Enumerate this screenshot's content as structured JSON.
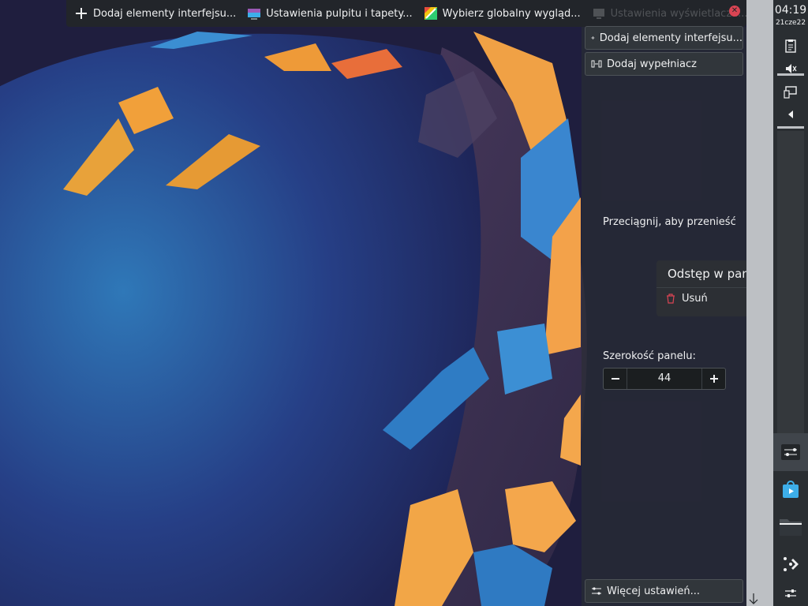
{
  "toolbox": {
    "items": [
      {
        "label": "Dodaj elementy interfejsu...",
        "icon": "plus-icon"
      },
      {
        "label": "Ustawienia pulpitu i tapety...",
        "icon": "desktop-settings-icon"
      },
      {
        "label": "Wybierz globalny wygląd...",
        "icon": "global-theme-icon"
      },
      {
        "label": "Ustawienia wyświetlacza...",
        "icon": "monitor-icon"
      }
    ],
    "close_icon": "close-icon"
  },
  "edit_panel": {
    "add_widgets": "Dodaj elementy interfejsu...",
    "add_spacer": "Dodaj wypełniacz",
    "drag_hint": "Przeciągnij, aby przenieść",
    "width_label": "Szerokość panelu:",
    "width_value": "44",
    "more_settings": "Więcej ustawień..."
  },
  "context_menu": {
    "title": "Odstęp w panelu",
    "remove": "Usuń"
  },
  "panel": {
    "time": "04:19",
    "date": "21cze22",
    "icons": [
      "clipboard-icon",
      "volume-muted-icon",
      "network-icon",
      "expand-arrow-icon",
      "panel-spacer-icon",
      "discover-store-icon",
      "file-manager-icon",
      "kde-connect-icon",
      "settings-icon"
    ]
  },
  "colors": {
    "accent": "#3daee9",
    "danger": "#da4453",
    "panel_bg": "#2a2e32"
  }
}
